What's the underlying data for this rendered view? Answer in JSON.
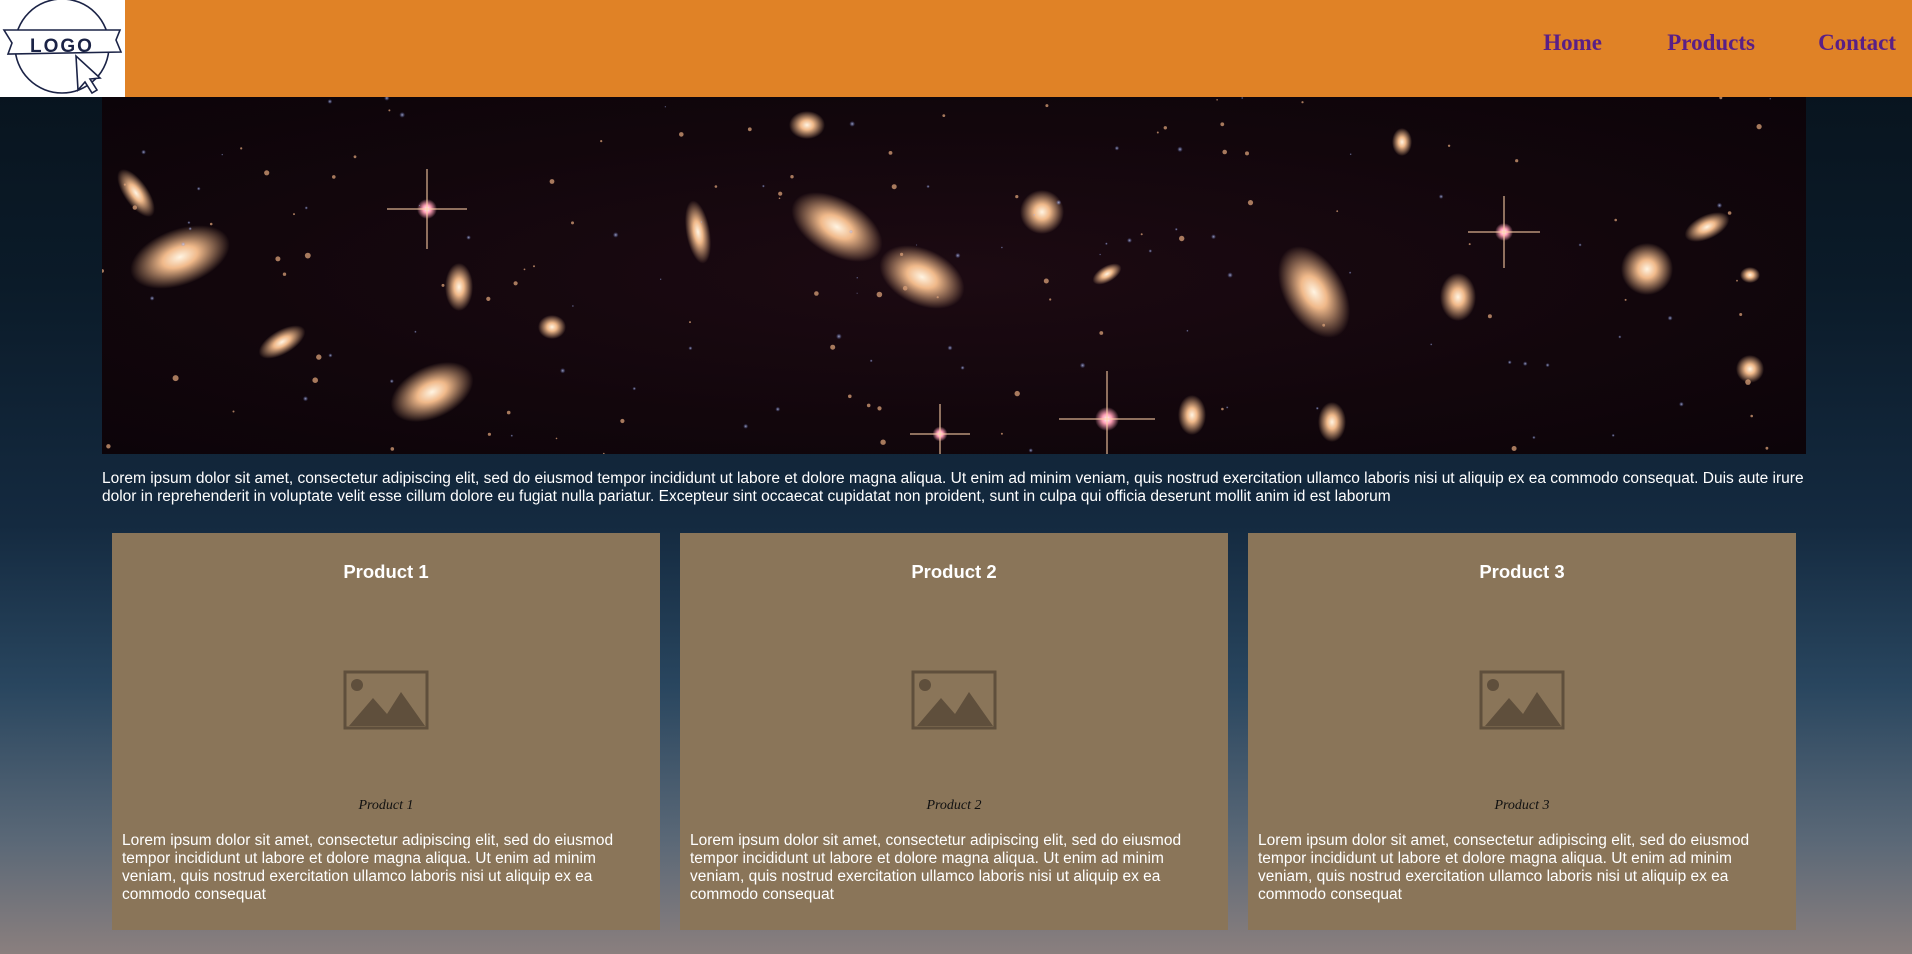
{
  "header": {
    "logo_text": "LOGO",
    "nav": [
      {
        "label": "Home"
      },
      {
        "label": "Products"
      },
      {
        "label": "Contact"
      }
    ],
    "background_color": "#e08226",
    "nav_color": "#5a1f86"
  },
  "hero": {
    "image_description_icon": "galaxy-field-image"
  },
  "intro": {
    "text": "Lorem ipsum dolor sit amet, consectetur adipiscing elit, sed do eiusmod tempor incididunt ut labore et dolore magna aliqua. Ut enim ad minim veniam, quis nostrud exercitation ullamco laboris nisi ut aliquip ex ea commodo consequat. Duis aute irure dolor in reprehenderit in voluptate velit esse cillum dolore eu fugiat nulla pariatur. Excepteur sint occaecat cupidatat non proident, sunt in culpa qui officia deserunt mollit anim id est laborum"
  },
  "products": [
    {
      "title": "Product 1",
      "caption": "Product 1",
      "description": "Lorem ipsum dolor sit amet, consectetur adipiscing elit, sed do eiusmod tempor incididunt ut labore et dolore magna aliqua. Ut enim ad minim veniam, quis nostrud exercitation ullamco laboris nisi ut aliquip ex ea commodo consequat"
    },
    {
      "title": "Product 2",
      "caption": "Product 2",
      "description": "Lorem ipsum dolor sit amet, consectetur adipiscing elit, sed do eiusmod tempor incididunt ut labore et dolore magna aliqua. Ut enim ad minim veniam, quis nostrud exercitation ullamco laboris nisi ut aliquip ex ea commodo consequat"
    },
    {
      "title": "Product 3",
      "caption": "Product 3",
      "description": "Lorem ipsum dolor sit amet, consectetur adipiscing elit, sed do eiusmod tempor incididunt ut labore et dolore magna aliqua. Ut enim ad minim veniam, quis nostrud exercitation ullamco laboris nisi ut aliquip ex ea commodo consequat"
    }
  ],
  "card_color": "#8a7559"
}
